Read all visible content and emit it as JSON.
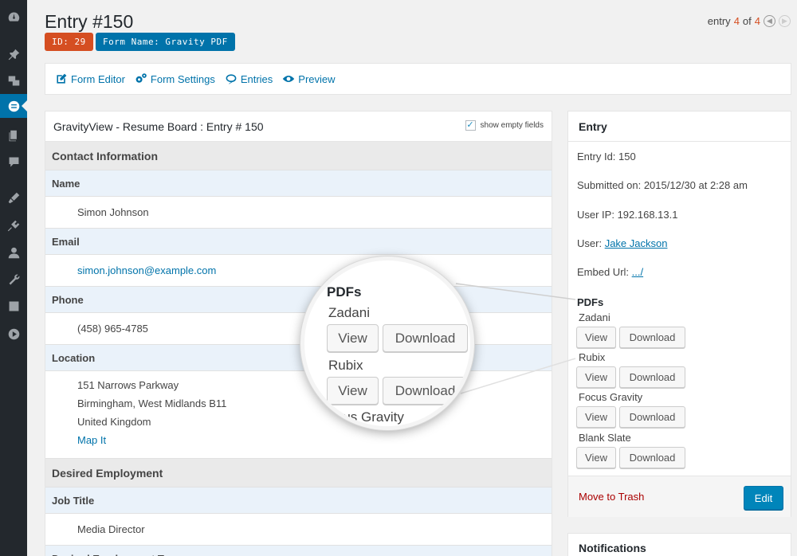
{
  "header": {
    "title": "Entry #150",
    "badge_id": "ID: 29",
    "badge_form": "Form Name: Gravity PDF",
    "nav_prefix": "entry",
    "nav_current": "4",
    "nav_of": "of",
    "nav_total": "4"
  },
  "toolbar": {
    "form_editor": "Form Editor",
    "form_settings": "Form Settings",
    "entries": "Entries",
    "preview": "Preview"
  },
  "main": {
    "title": "GravityView - Resume Board : Entry # 150",
    "show_empty_label": "show empty fields",
    "contact_section": "Contact Information",
    "name_label": "Name",
    "name_value": "Simon Johnson",
    "email_label": "Email",
    "email_value": "simon.johnson@example.com",
    "phone_label": "Phone",
    "phone_value": "(458) 965-4785",
    "location_label": "Location",
    "location_line1": "151 Narrows Parkway",
    "location_line2": "Birmingham, West Midlands B11",
    "location_line3": "United Kingdom",
    "map_link": "Map It",
    "employment_section": "Desired Employment",
    "job_title_label": "Job Title",
    "job_title_value": "Media Director",
    "employment_type_label": "Desired Employment Type"
  },
  "side": {
    "title": "Entry",
    "entry_id": "Entry Id: 150",
    "submitted": "Submitted on: 2015/12/30 at 2:28 am",
    "user_ip": "User IP: 192.168.13.1",
    "user_prefix": "User:",
    "user_link": "Jake Jackson",
    "embed_prefix": "Embed Url:",
    "embed_link": ".../",
    "pdfs_title": "PDFs",
    "pdfs": [
      {
        "name": "Zadani",
        "view": "View",
        "download": "Download"
      },
      {
        "name": "Rubix",
        "view": "View",
        "download": "Download"
      },
      {
        "name": "Focus Gravity",
        "view": "View",
        "download": "Download"
      },
      {
        "name": "Blank Slate",
        "view": "View",
        "download": "Download"
      }
    ],
    "trash": "Move to Trash",
    "edit": "Edit"
  },
  "notifications": {
    "title": "Notifications"
  },
  "magnifier": {
    "title": "PDFs",
    "name1": "Zadani",
    "view1": "View",
    "download1": "Download",
    "name2": "Rubix",
    "view2": "View",
    "download2": "Download",
    "name3": "Focus Gravity"
  },
  "colors": {
    "accent": "#0073aa",
    "badge_id": "#d54e21",
    "trash": "#a00000",
    "sidebar": "#23282d"
  }
}
